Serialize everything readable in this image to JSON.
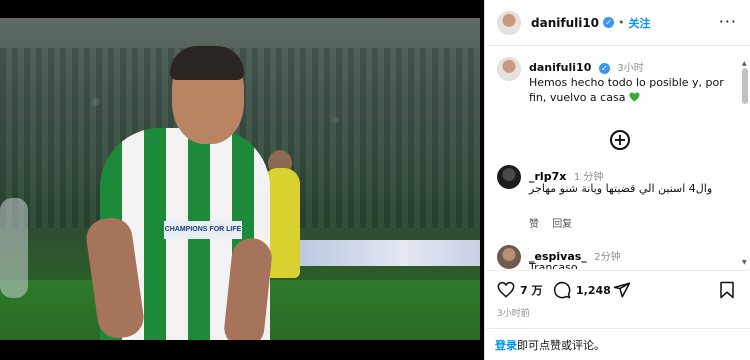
{
  "post": {
    "username": "danifuli10",
    "verified_mark": "✓",
    "separator": "•",
    "follow_label": "关注",
    "more_label": "···"
  },
  "caption": {
    "username": "danifuli10",
    "time": "3小时",
    "text": "Hemos hecho todo lo posible y, por fin, vuelvo a casa",
    "emoji": "green-heart-icon"
  },
  "photo": {
    "sponsor_text": "CHAMPIONS FOR LIFE"
  },
  "comments": [
    {
      "username": "_rlp7x",
      "time": "1 分钟",
      "text": "وال4 اسنين الي قضيتها ويانة شنو مهاجر",
      "like_label": "赞",
      "reply_label": "回复"
    },
    {
      "username": "_espivas_",
      "time": "2分钟",
      "text": "Trancaso"
    }
  ],
  "actions": {
    "likes": "7 万",
    "comments": "1,248",
    "post_time": "3小时前"
  },
  "login": {
    "link_label": "登录",
    "rest_label": "即可点赞或评论。"
  },
  "colors": {
    "accent": "#0095f6",
    "verified": "#3897f0"
  }
}
